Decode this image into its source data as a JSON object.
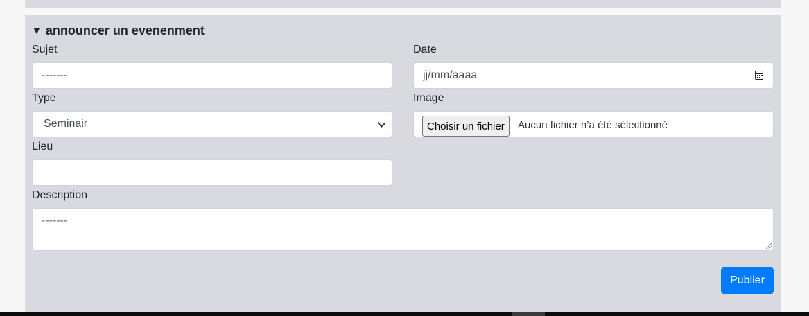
{
  "form": {
    "section_title": "announcer un evenenment",
    "sujet": {
      "label": "Sujet",
      "placeholder": "-------"
    },
    "date": {
      "label": "Date",
      "placeholder": "jj/mm/aaaa"
    },
    "type": {
      "label": "Type",
      "selected": "Seminair"
    },
    "image": {
      "label": "Image",
      "button_label": "Choisir un fichier",
      "status": "Aucun fichier n’a été sélectionné"
    },
    "lieu": {
      "label": "Lieu",
      "value": ""
    },
    "description": {
      "label": "Description",
      "placeholder": "-------"
    },
    "submit_label": "Publier"
  },
  "colors": {
    "panel_bg": "#d9dadf",
    "primary": "#007bff"
  }
}
